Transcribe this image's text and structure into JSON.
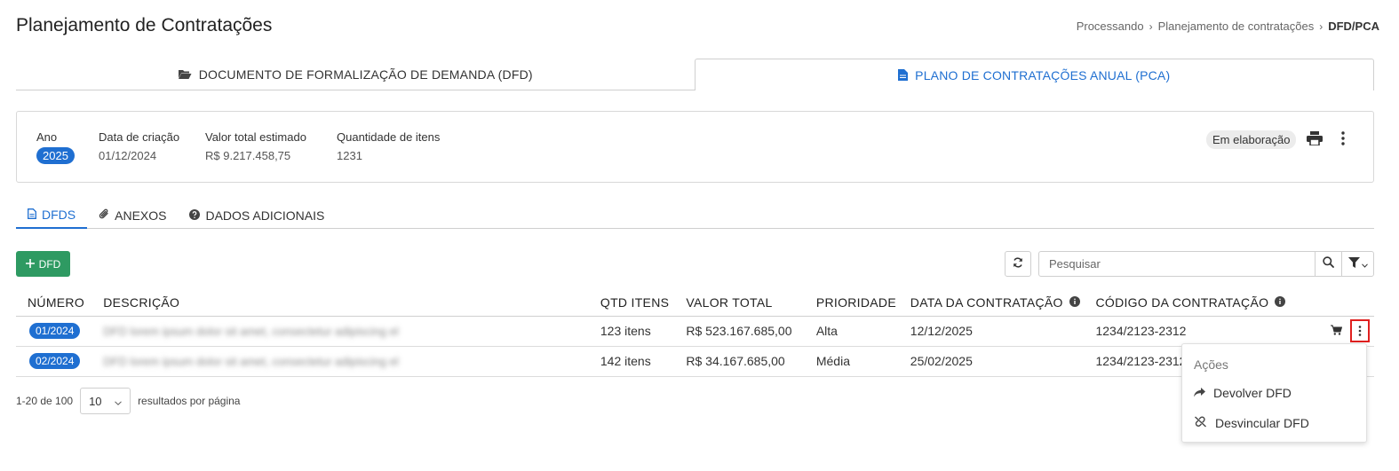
{
  "page": {
    "title": "Planejamento de Contratações",
    "breadcrumb": [
      "Processando",
      "Planejamento de contratações",
      "DFD/PCA"
    ]
  },
  "main_tabs": [
    {
      "label": "DOCUMENTO DE FORMALIZAÇÃO DE DEMANDA (DFD)",
      "icon": "folder-open-icon",
      "active": false
    },
    {
      "label": "PLANO DE CONTRATAÇÕES ANUAL (PCA)",
      "icon": "file-icon",
      "active": true
    }
  ],
  "info": {
    "year_label": "Ano",
    "year_value": "2025",
    "created_label": "Data de criação",
    "created_value": "01/12/2024",
    "total_label": "Valor total estimado",
    "total_value": "R$ 9.217.458,75",
    "qty_label": "Quantidade de itens",
    "qty_value": "1231",
    "status": "Em elaboração"
  },
  "sub_tabs": [
    {
      "label": "DFDS",
      "icon": "document-icon",
      "active": true
    },
    {
      "label": "ANEXOS",
      "icon": "paperclip-icon",
      "active": false
    },
    {
      "label": "DADOS ADICIONAIS",
      "icon": "question-circle-icon",
      "active": false
    }
  ],
  "toolbar": {
    "add_label": "DFD",
    "search_placeholder": "Pesquisar"
  },
  "table": {
    "headers": [
      "NÚMERO",
      "DESCRIÇÃO",
      "QTD ITENS",
      "VALOR TOTAL",
      "PRIORIDADE",
      "DATA DA CONTRATAÇÃO",
      "CÓDIGO DA CONTRATAÇÃO"
    ],
    "rows": [
      {
        "numero": "01/2024",
        "descricao": "DFD lorem ipsum dolor sit amet, consectetur adipiscing el",
        "qtd": "123 itens",
        "valor": "R$ 523.167.685,00",
        "prioridade": "Alta",
        "data": "12/12/2025",
        "codigo": "1234/2123-2312"
      },
      {
        "numero": "02/2024",
        "descricao": "DFD lorem ipsum dolor sit amet, consectetur adipiscing el",
        "qtd": "142 itens",
        "valor": "R$ 34.167.685,00",
        "prioridade": "Média",
        "data": "25/02/2025",
        "codigo": "1234/2123-2312"
      }
    ]
  },
  "pager": {
    "range": "1-20 de 100",
    "per_page": "10",
    "per_page_label": "resultados por página"
  },
  "menu": {
    "title": "Ações",
    "items": [
      {
        "label": "Devolver DFD",
        "icon": "share-icon"
      },
      {
        "label": "Desvincular DFD",
        "icon": "unlink-icon"
      }
    ]
  },
  "colors": {
    "primary": "#1f6fd1",
    "success": "#2e9a62",
    "highlight": "#e0201f"
  }
}
